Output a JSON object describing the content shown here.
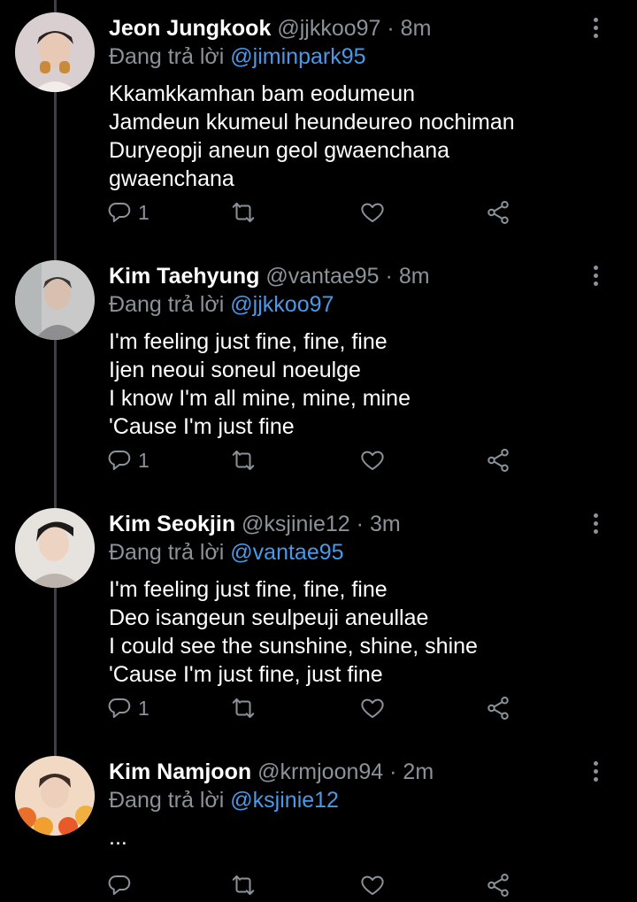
{
  "colors": {
    "background": "#000000",
    "name": "#ffffff",
    "secondary": "#8b9299",
    "mention": "#4a99e9",
    "thread_line": "#3d4044"
  },
  "reply_prefix": "Đang trả lời",
  "tweets": [
    {
      "name": "Jeon Jungkook",
      "handle": "@jjkkoo97",
      "time": "8m",
      "replying_to": "@jiminpark95",
      "lines": [
        "Kkamkkamhan bam eodumeun",
        "Jamdeun kkumeul heundeureo nochiman",
        "Duryeopji aneun geol gwaenchana",
        "gwaenchana"
      ],
      "reply_count": "1"
    },
    {
      "name": "Kim Taehyung",
      "handle": "@vantae95",
      "time": "8m",
      "replying_to": "@jjkkoo97",
      "lines": [
        "I'm feeling just fine, fine, fine",
        "Ijen neoui soneul noeulge",
        "I know I'm all mine, mine, mine",
        "'Cause I'm just fine"
      ],
      "reply_count": "1"
    },
    {
      "name": "Kim Seokjin",
      "handle": "@ksjinie12",
      "time": "3m",
      "replying_to": "@vantae95",
      "lines": [
        "I'm feeling just fine, fine, fine",
        "Deo isangeun seulpeuji aneullae",
        "I could see the sunshine, shine, shine",
        "'Cause I'm just fine, just fine"
      ],
      "reply_count": "1"
    },
    {
      "name": "Kim Namjoon",
      "handle": "@krmjoon94",
      "time": "2m",
      "replying_to": "@ksjinie12",
      "lines": [
        "..."
      ],
      "reply_count": ""
    }
  ]
}
